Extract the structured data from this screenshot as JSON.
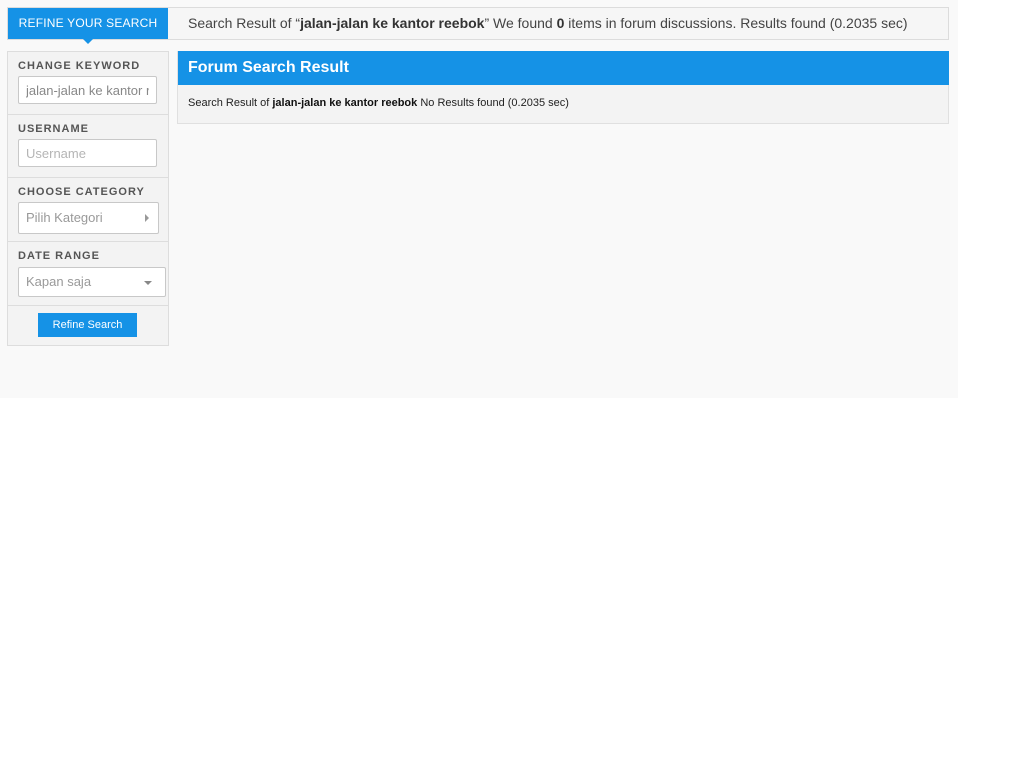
{
  "summary": {
    "tab_label": "REFINE YOUR SEARCH",
    "prefix": "Search Result of “",
    "keyword": "jalan-jalan ke kantor reebok",
    "middle": "” We found ",
    "count": "0",
    "suffix": " items in forum discussions. Results found (0.2035 sec)"
  },
  "sidebar": {
    "keyword": {
      "label": "CHANGE KEYWORD",
      "value": "jalan-jalan ke kantor reebok"
    },
    "username": {
      "label": "USERNAME",
      "placeholder": "Username"
    },
    "category": {
      "label": "CHOOSE CATEGORY",
      "value": "Pilih Kategori",
      "icon": "chevron-right-icon"
    },
    "date_range": {
      "label": "DATE RANGE",
      "value": "Kapan saja",
      "icon": "chevron-down-icon"
    },
    "refine_button": "Refine Search"
  },
  "results": {
    "title": "Forum Search Result",
    "prefix": "Search Result of ",
    "keyword": "jalan-jalan ke kantor reebok",
    "status": " No Results found (0.2035 sec)"
  },
  "colors": {
    "accent": "#1592e6",
    "panel_bg": "#f3f3f3",
    "page_bg": "#f9f9f9"
  }
}
